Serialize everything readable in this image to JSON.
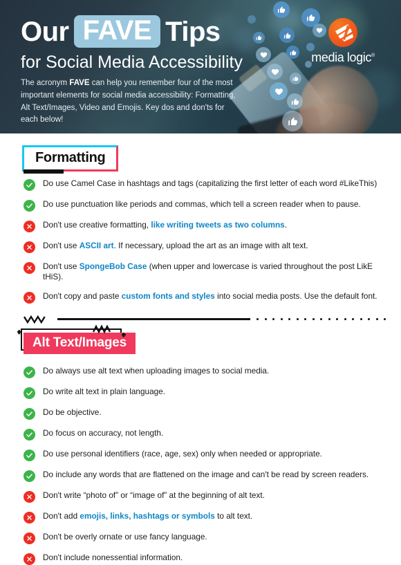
{
  "header": {
    "title_pre": "Our",
    "title_highlight": "FAVE",
    "title_post": "Tips",
    "subtitle": "for Social Media Accessibility",
    "paragraph_part1": "The acronym ",
    "paragraph_bold": "FAVE",
    "paragraph_part2": " can help you remember four of the most important elements for social media accessibility: Formatting, Alt Text/Images, Video and Emojis. Key dos and don'ts for each below!",
    "logo_text": "media logic",
    "logo_registered": "®",
    "colors": {
      "highlight_chip": "#9cc8de",
      "background": "#2a3d49",
      "logo_orange": "#ef5a1a"
    }
  },
  "sections": [
    {
      "heading": "Formatting",
      "heading_style": "outline-cyan-pink",
      "items": [
        {
          "type": "do",
          "segments": [
            {
              "text": "Do use Camel Case in hashtags and tags (capitalizing the first letter of each word #LikeThis)",
              "highlight": false
            }
          ]
        },
        {
          "type": "do",
          "segments": [
            {
              "text": "Do use punctuation like periods and commas, which tell a screen reader when to pause.",
              "highlight": false
            }
          ]
        },
        {
          "type": "dont",
          "segments": [
            {
              "text": "Don't use creative formatting, ",
              "highlight": false
            },
            {
              "text": "like writing tweets as two columns",
              "highlight": true
            },
            {
              "text": ".",
              "highlight": false
            }
          ]
        },
        {
          "type": "dont",
          "segments": [
            {
              "text": "Don't use ",
              "highlight": false
            },
            {
              "text": "ASCII art",
              "highlight": true
            },
            {
              "text": ". If necessary, upload the art as an image with alt text.",
              "highlight": false
            }
          ]
        },
        {
          "type": "dont",
          "segments": [
            {
              "text": "Don't use ",
              "highlight": false
            },
            {
              "text": "SpongeBob Case",
              "highlight": true
            },
            {
              "text": " (when upper and lowercase is varied throughout the post LikE tHiS).",
              "highlight": false
            }
          ]
        },
        {
          "type": "dont",
          "segments": [
            {
              "text": "Don't copy and paste ",
              "highlight": false
            },
            {
              "text": "custom fonts and styles",
              "highlight": true
            },
            {
              "text": " into social media posts. Use the default font.",
              "highlight": false
            }
          ]
        }
      ]
    },
    {
      "heading": "Alt Text/Images",
      "heading_style": "filled-pink",
      "items": [
        {
          "type": "do",
          "segments": [
            {
              "text": "Do always use alt text when uploading images to social media.",
              "highlight": false
            }
          ]
        },
        {
          "type": "do",
          "segments": [
            {
              "text": "Do write alt text in plain language.",
              "highlight": false
            }
          ]
        },
        {
          "type": "do",
          "segments": [
            {
              "text": "Do be objective.",
              "highlight": false
            }
          ]
        },
        {
          "type": "do",
          "segments": [
            {
              "text": "Do focus on accuracy, not length.",
              "highlight": false
            }
          ]
        },
        {
          "type": "do",
          "segments": [
            {
              "text": "Do use personal identifiers (race, age, sex) only when needed or appropriate.",
              "highlight": false
            }
          ]
        },
        {
          "type": "do",
          "segments": [
            {
              "text": "Do include any words that are flattened on the image and can't be read by screen readers.",
              "highlight": false
            }
          ]
        },
        {
          "type": "dont",
          "segments": [
            {
              "text": "Don't write “photo of” or “image of” at the beginning of alt text.",
              "highlight": false
            }
          ]
        },
        {
          "type": "dont",
          "segments": [
            {
              "text": "Don't add ",
              "highlight": false
            },
            {
              "text": "emojis, links, hashtags or symbols",
              "highlight": true
            },
            {
              "text": " to alt text.",
              "highlight": false
            }
          ]
        },
        {
          "type": "dont",
          "segments": [
            {
              "text": "Don't be overly ornate or use fancy language.",
              "highlight": false
            }
          ]
        },
        {
          "type": "dont",
          "segments": [
            {
              "text": "Don't include nonessential information.",
              "highlight": false
            }
          ]
        }
      ]
    }
  ],
  "divider": {
    "dot_count": 17
  },
  "icons": {
    "do": "check-circle-icon",
    "dont": "x-circle-icon"
  },
  "theme": {
    "do_green": "#3cb44a",
    "dont_red": "#ee2d24",
    "link_blue": "#0f86c4",
    "accent_cyan": "#15c9f2",
    "accent_pink": "#f0395c"
  }
}
